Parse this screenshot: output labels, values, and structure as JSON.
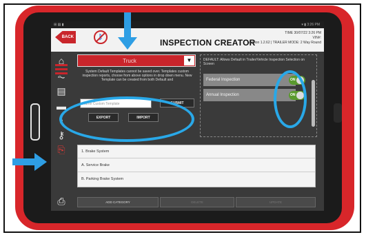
{
  "statusbar": {
    "left": "⊞ ▤ ▮",
    "right": "▾ ▮ 3:26 PM"
  },
  "header": {
    "back_label": "BACK",
    "title": "INSPECTION CREATOR",
    "time": "TIME 30/07/22 3:26 PM",
    "vin": "VIN#:",
    "version": "Version 1.2.62 | TRAILER MODE: 2 Way Round"
  },
  "sidebar": {
    "icons": [
      "menu-icon",
      "home-icon",
      "pulse-icon",
      "document-icon",
      "folder-icon",
      "lightbulb-icon",
      "key-icon",
      "export-icon",
      "scanner-icon"
    ]
  },
  "template": {
    "selected": "Truck",
    "arrow": "▼",
    "info": "System Default Templates cannot be saved over. Templates custom inspection reports, choose from above options in drop down menu. New Template can be created from both Default and",
    "name_placeholder": "Name Custom Template",
    "submit_label": "SUBMIT",
    "export_label": "EXPORT",
    "import_label": "IMPORT"
  },
  "panel": {
    "default_text": "DEFAULT: Allows Default in Trailer/Vehicle Inspection Selection on Screen",
    "inspections": [
      {
        "label": "Federal Inspection",
        "state": "ON"
      },
      {
        "label": "Annual Inspection",
        "state": "ON"
      }
    ]
  },
  "categories": [
    {
      "label": "1. Brake System"
    },
    {
      "label": "A. Service Brake"
    },
    {
      "label": "B. Parking Brake System"
    }
  ],
  "bottom": {
    "add_label": "ADD CATEGORY",
    "delete_label": "DELETE",
    "update_label": "UPDATE"
  },
  "colors": {
    "accent": "#c9252b",
    "highlight": "#29a8e8",
    "toggle_on": "#5a9a2e"
  }
}
